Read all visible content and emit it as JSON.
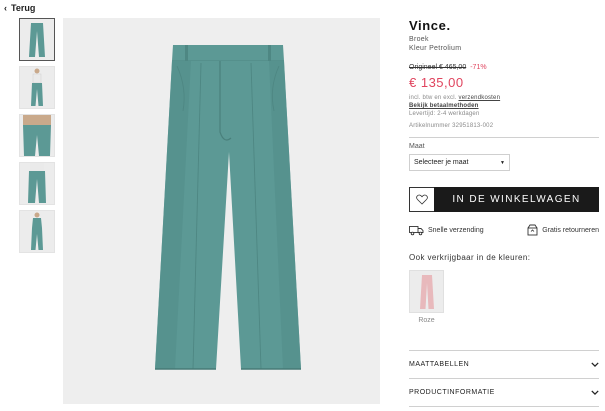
{
  "nav": {
    "back_label": "Terug"
  },
  "gallery": {
    "thumbnail_count": 5,
    "active_index": 0
  },
  "product": {
    "brand": "Vince.",
    "type": "Broek",
    "color_line": "Kleur Petrolium",
    "original_price": "Origineel € 465,00",
    "discount": "-71%",
    "price": "€ 135,00",
    "tax_prefix": "incl. btw en excl.",
    "shipping_link": "verzendkosten",
    "payment_link": "Bekijk betaalmethoden",
    "delivery": "Levertijd: 2-4 werkdagen",
    "article_number": "Artikelnummer 32951813-002",
    "product_color": "#5c9995"
  },
  "size": {
    "label": "Maat",
    "placeholder": "Selecteer je maat"
  },
  "cart": {
    "add_label": "IN DE WINKELWAGEN"
  },
  "usps": [
    {
      "icon": "truck-icon",
      "label": "Snelle verzending"
    },
    {
      "icon": "return-box-icon",
      "label": "Gratis retourneren"
    }
  ],
  "colors": {
    "title": "Ook verkrijgbaar in de kleuren:",
    "options": [
      {
        "label": "Roze",
        "swatch": "#e8b9bc"
      }
    ]
  },
  "accordions": [
    {
      "label": "MAATTABELLEN"
    },
    {
      "label": "PRODUCTINFORMATIE"
    }
  ]
}
